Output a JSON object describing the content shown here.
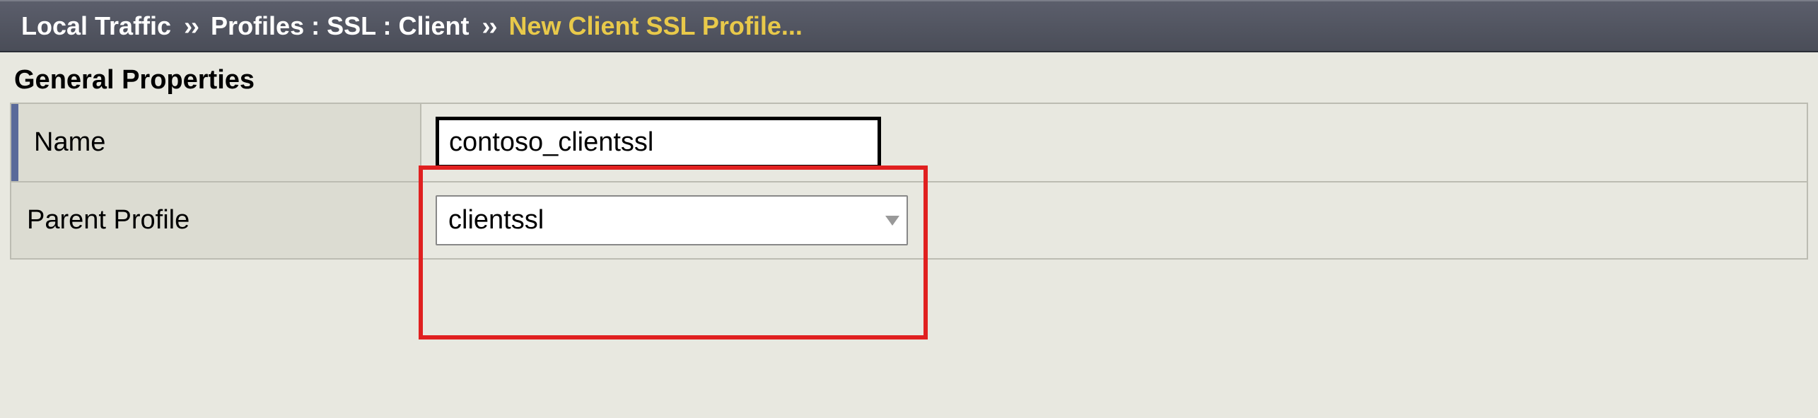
{
  "breadcrumb": {
    "root": "Local Traffic",
    "sep": "››",
    "path": "Profiles : SSL : Client",
    "current": "New Client SSL Profile..."
  },
  "section_title": "General Properties",
  "fields": {
    "name": {
      "label": "Name",
      "value": "contoso_clientssl"
    },
    "parent_profile": {
      "label": "Parent Profile",
      "value": "clientssl"
    }
  }
}
